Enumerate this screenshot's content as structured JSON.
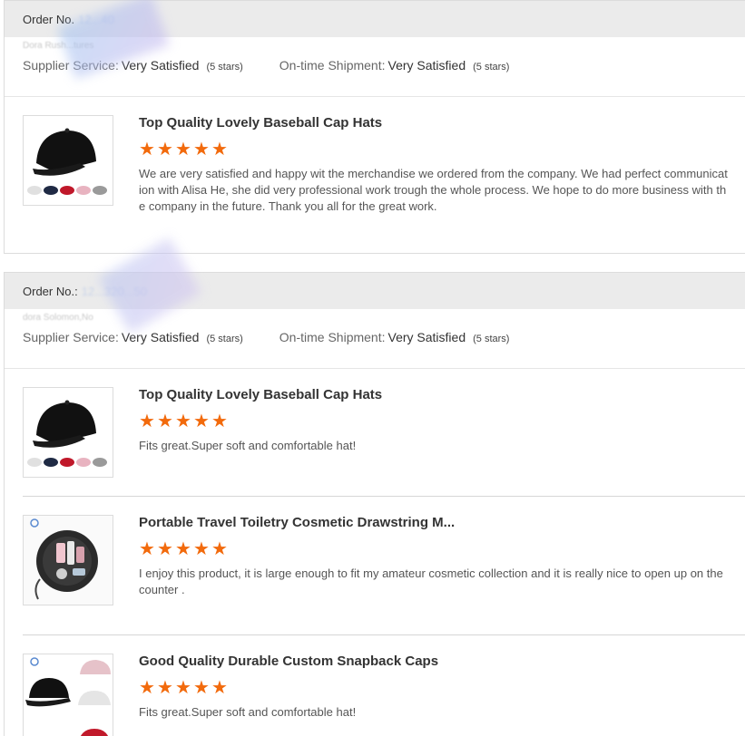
{
  "orders": [
    {
      "order_label": "Order No.",
      "order_number": "12...40",
      "buyer_name": "Dora Rush...tures",
      "supplier_service_label": "Supplier Service:",
      "supplier_service_value": "Very Satisfied",
      "supplier_service_stars": "(5 stars)",
      "shipment_label": "On-time Shipment:",
      "shipment_value": "Very Satisfied",
      "shipment_stars": "(5 stars)",
      "items": [
        {
          "title": "Top Quality Lovely Baseball Cap Hats",
          "rating": 5,
          "review": "We are very satisfied and happy wit the merchandise we ordered from the company. We had perfect communication with Alisa He, she did very professional work trough the whole process. We hope to do more business with the company in the future. Thank you all for the great work."
        }
      ]
    },
    {
      "order_label": "Order No.:",
      "order_number": "12...320...50",
      "buyer_name": "dora Solomon,No",
      "supplier_service_label": "Supplier Service:",
      "supplier_service_value": "Very Satisfied",
      "supplier_service_stars": "(5 stars)",
      "shipment_label": "On-time Shipment:",
      "shipment_value": "Very Satisfied",
      "shipment_stars": "(5 stars)",
      "items": [
        {
          "title": "Top Quality Lovely Baseball Cap Hats",
          "rating": 5,
          "review": "Fits great.Super soft and comfortable hat!"
        },
        {
          "title": "Portable Travel Toiletry Cosmetic Drawstring M...",
          "rating": 5,
          "review": "I enjoy this product, it is large enough to fit my amateur cosmetic collection and it is really nice to open up on the counter ."
        },
        {
          "title": "Good Quality Durable Custom Snapback Caps",
          "rating": 5,
          "review": "Fits great.Super soft and comfortable hat!"
        }
      ]
    }
  ],
  "colors": {
    "star": "#f26a0c",
    "header_bg": "#ebebeb"
  },
  "icons": {
    "star": "star-icon"
  }
}
